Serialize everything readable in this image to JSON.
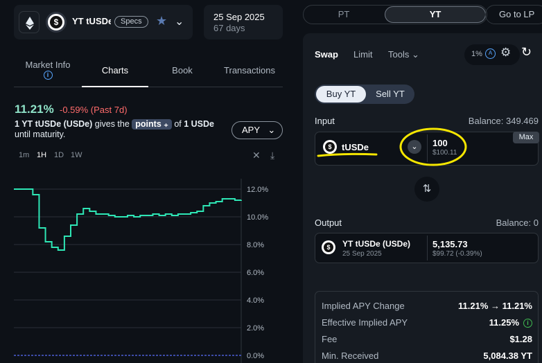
{
  "header": {
    "chain_icon": "ethereum-icon",
    "asset_name": "YT tUSDe",
    "specs_label": "Specs",
    "maturity_date": "25 Sep 2025",
    "days_left": "67 days"
  },
  "left_tabs": [
    "Market Info",
    "Charts",
    "Book",
    "Transactions"
  ],
  "market": {
    "apy": "11.21%",
    "change": "-0.59% (Past 7d)",
    "desc_prefix": "1 YT tUSDe (USDe)",
    "desc_mid": " gives the ",
    "points_label": "points",
    "desc_of": " of ",
    "desc_amount": "1 USDe",
    "desc_suffix": "until maturity.",
    "metric_select": "APY",
    "timeframes": [
      "1m",
      "1H",
      "1D",
      "1W"
    ]
  },
  "chart_data": {
    "type": "line",
    "yticks": [
      "12.0%",
      "10.0%",
      "8.0%",
      "6.0%",
      "4.0%",
      "2.0%",
      "0.0%"
    ],
    "ylim": [
      0,
      12.0
    ],
    "series": [
      {
        "values": [
          12.0,
          12.0,
          12.0,
          11.6,
          9.2,
          8.2,
          7.8,
          7.6,
          8.6,
          9.4,
          10.2,
          10.6,
          10.4,
          10.2,
          10.2,
          10.1,
          10.0,
          10.0,
          10.1,
          10.0,
          10.1,
          10.1,
          10.2,
          10.1,
          10.2,
          10.1,
          10.2,
          10.2,
          10.3,
          10.4,
          10.8,
          11.0,
          11.1,
          11.3,
          11.3,
          11.2,
          11.21
        ]
      }
    ],
    "baseline": 0.0,
    "line_color": "#2ee6b5",
    "baseline_color": "#4c5fd5"
  },
  "top_tabs": {
    "pt": "PT",
    "yt": "YT",
    "lp": "Go to LP"
  },
  "panel": {
    "tabs": [
      "Swap",
      "Limit",
      "Tools"
    ],
    "slippage": "1%",
    "buy_label": "Buy YT",
    "sell_label": "Sell YT",
    "input_label": "Input",
    "input_balance": "Balance: 349.469",
    "input_token": "tUSDe",
    "max_label": "Max",
    "input_amount": "100",
    "input_usd": "$100.11",
    "output_label": "Output",
    "output_balance": "Balance: 0",
    "output_token": "YT tUSDe (USDe)",
    "output_date": "25 Sep 2025",
    "output_amount": "5,135.73",
    "output_usd": "$99.72 (-0.39%)"
  },
  "summary": [
    {
      "label": "Implied APY Change",
      "value": "11.21% → 11.21%"
    },
    {
      "label": "Effective Implied APY",
      "value": "11.25%"
    },
    {
      "label": "Fee",
      "value": "$1.28"
    },
    {
      "label": "Min. Received",
      "value": "5,084.38 YT"
    }
  ],
  "colors": {
    "accent": "#8fe3c8",
    "negative": "#ff6b6b",
    "highlight": "#f5e600"
  }
}
